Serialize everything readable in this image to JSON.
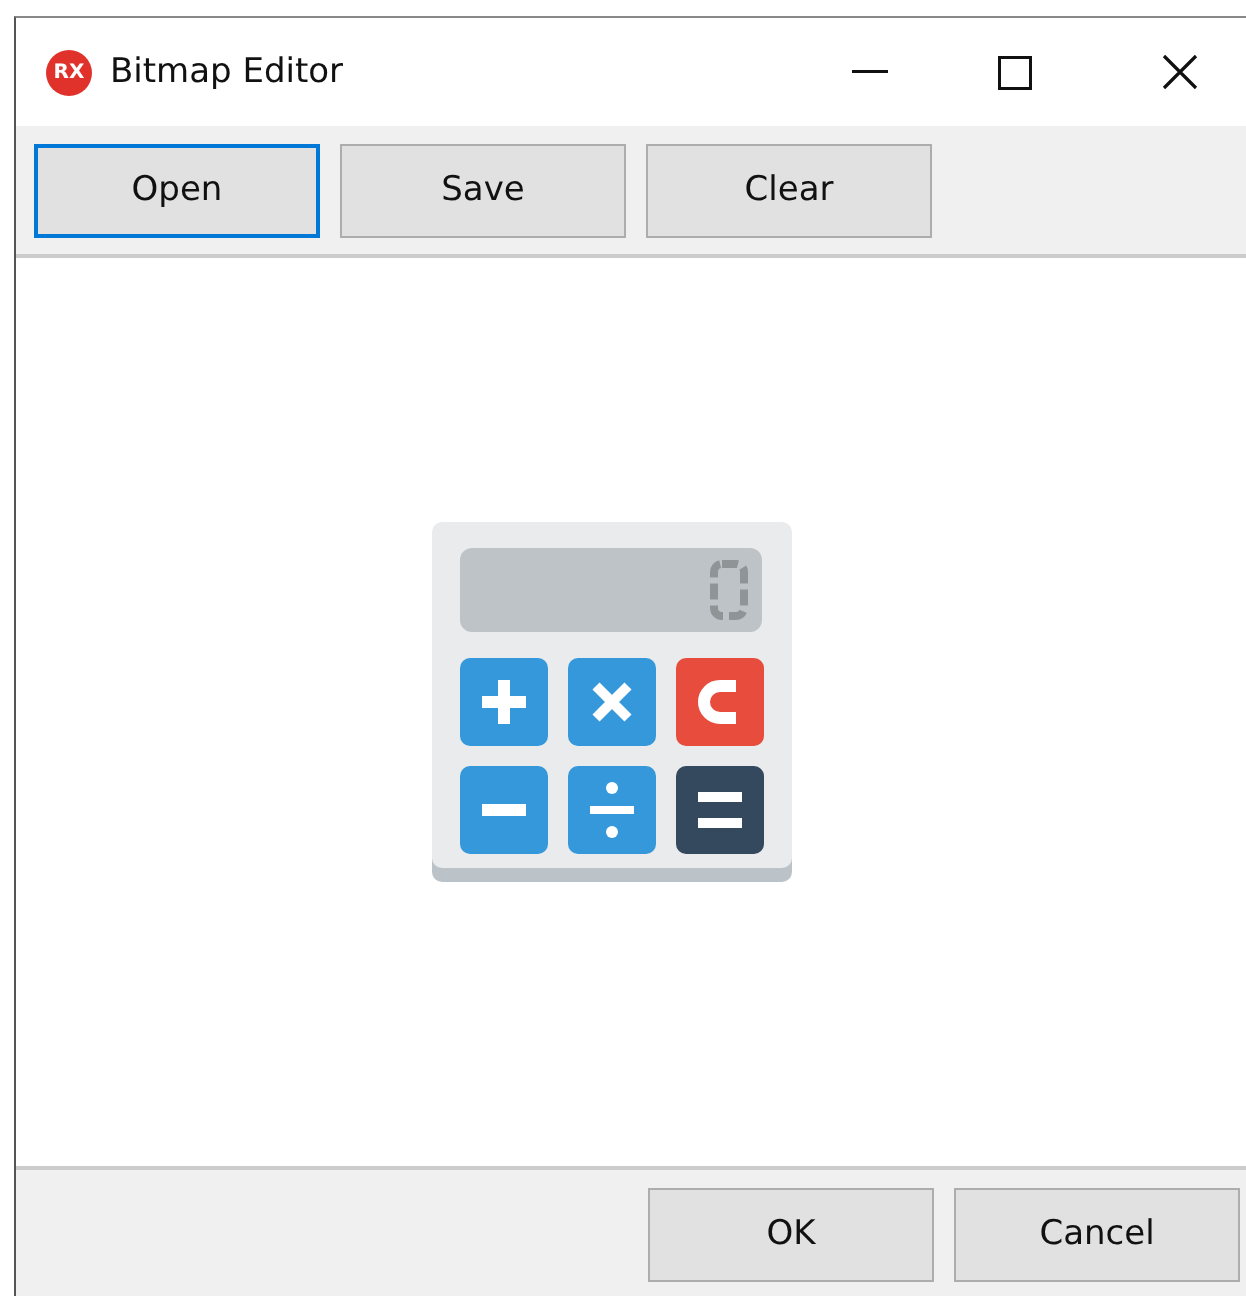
{
  "window": {
    "logo": "RX",
    "title": "Bitmap Editor"
  },
  "toolbar": [
    {
      "label": "Open",
      "focused": true
    },
    {
      "label": "Save",
      "focused": false
    },
    {
      "label": "Clear",
      "focused": false
    }
  ],
  "footer_buttons": [
    {
      "label": "OK",
      "focused": false
    },
    {
      "label": "Cancel",
      "focused": false
    }
  ]
}
